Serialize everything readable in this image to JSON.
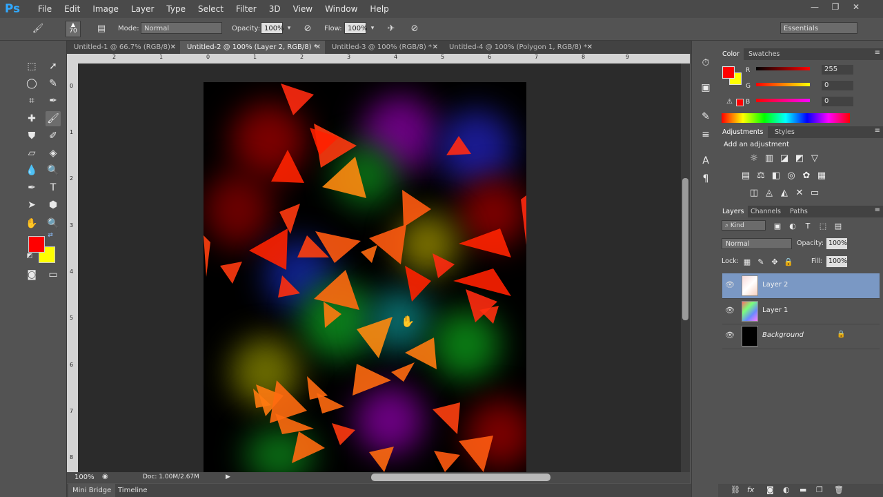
{
  "app": {
    "logo": "Ps"
  },
  "menu": [
    "File",
    "Edit",
    "Image",
    "Layer",
    "Type",
    "Select",
    "Filter",
    "3D",
    "View",
    "Window",
    "Help"
  ],
  "window_controls": {
    "minimize": "—",
    "restore": "❐",
    "close": "✕"
  },
  "options_bar": {
    "brush_size": "70",
    "mode_label": "Mode:",
    "mode_value": "Normal",
    "opacity_label": "Opacity:",
    "opacity_value": "100%",
    "flow_label": "Flow:",
    "flow_value": "100%",
    "workspace": "Essentials"
  },
  "doc_tabs": [
    {
      "label": "Untitled-1 @ 66.7% (RGB/8)"
    },
    {
      "label": "Untitled-2 @ 100% (Layer 2, RGB/8) *",
      "active": true
    },
    {
      "label": "Untitled-3 @ 100% (RGB/8) *"
    },
    {
      "label": "Untitled-4 @ 100% (Polygon 1, RGB/8) *"
    }
  ],
  "ruler": {
    "h_ticks": [
      "2",
      "1",
      "0",
      "1",
      "2",
      "3",
      "4",
      "5",
      "6",
      "7",
      "8",
      "9"
    ],
    "v_ticks": [
      "0",
      "1",
      "2",
      "3",
      "4",
      "5",
      "6",
      "7",
      "8"
    ]
  },
  "status": {
    "zoom": "100%",
    "doc": "Doc: 1.00M/2.67M"
  },
  "bottom_tabs": [
    "Mini Bridge",
    "Timeline"
  ],
  "color_panel": {
    "tabs": [
      "Color",
      "Swatches"
    ],
    "foreground": "#ff0000",
    "background": "#ffff00",
    "r_label": "R",
    "r_value": "255",
    "g_label": "G",
    "g_value": "0",
    "b_label": "B",
    "b_value": "0"
  },
  "adjustments_panel": {
    "tabs": [
      "Adjustments",
      "Styles"
    ],
    "hint": "Add an adjustment"
  },
  "layers_panel": {
    "tabs": [
      "Layers",
      "Channels",
      "Paths"
    ],
    "filter_kind": "Kind",
    "blend_mode": "Normal",
    "opacity_label": "Opacity:",
    "opacity_value": "100%",
    "lock_label": "Lock:",
    "fill_label": "Fill:",
    "fill_value": "100%",
    "layers": [
      {
        "name": "Layer 2",
        "selected": true
      },
      {
        "name": "Layer 1"
      },
      {
        "name": "Background",
        "locked": true
      }
    ],
    "footer_icons": [
      "link-icon",
      "fx-icon",
      "mask-icon",
      "adjustment-icon",
      "folder-icon",
      "new-layer-icon",
      "trash-icon"
    ]
  },
  "colors": {
    "accent": "#31a8ff",
    "selection": "#7a98c4"
  }
}
